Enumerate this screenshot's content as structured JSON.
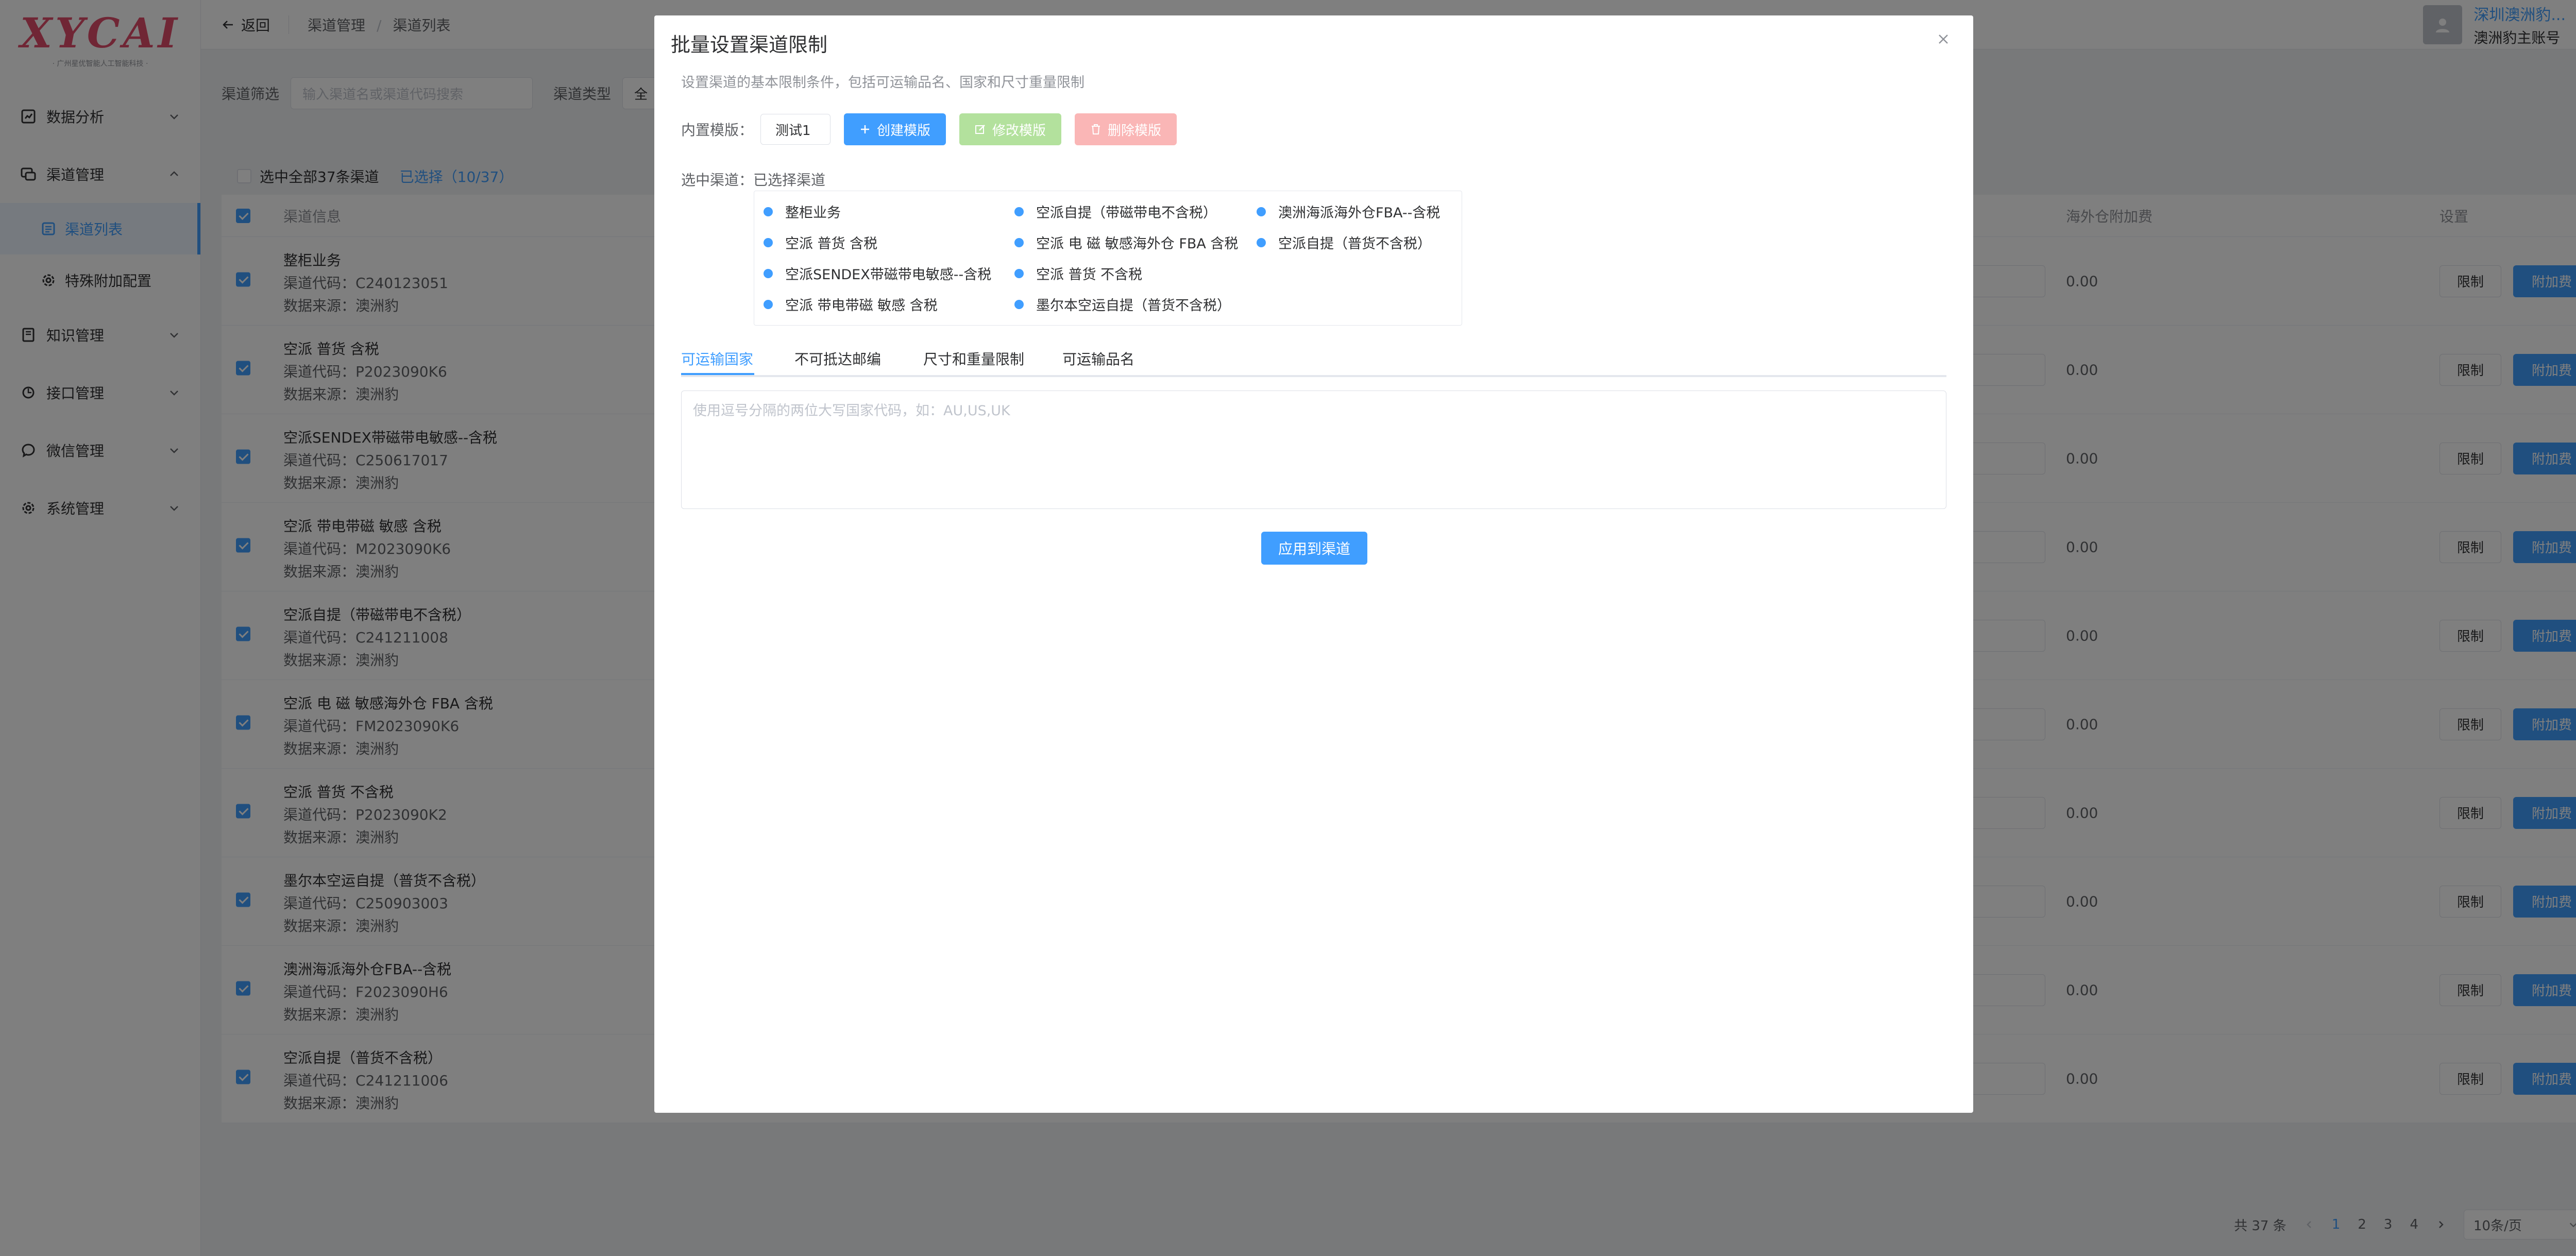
{
  "sidebar": {
    "logo_text": "XYCAI",
    "logo_sub": "· 广州星优智能人工智能科技 ·",
    "menu": {
      "data_analysis": "数据分析",
      "channel_mgmt": "渠道管理",
      "channel_list": "渠道列表",
      "special_fee_config": "特殊附加配置",
      "knowledge_mgmt": "知识管理",
      "api_mgmt": "接口管理",
      "wechat_mgmt": "微信管理",
      "system_mgmt": "系统管理"
    }
  },
  "header": {
    "back": "返回",
    "breadcrumb": [
      "渠道管理",
      "渠道列表"
    ],
    "user_name": "深圳澳洲豹...",
    "user_sub": "澳洲豹主账号"
  },
  "filter": {
    "label": "渠道筛选",
    "search_placeholder": "输入渠道名或渠道代码搜索",
    "type_label": "渠道类型",
    "type_value": "全"
  },
  "list": {
    "select_all": "选中全部37条渠道",
    "selected_count": "已选择（10/37）",
    "col_info": "渠道信息",
    "col_overseas_fee": "海外仓附加费",
    "col_settings": "设置",
    "code_prefix": "渠道代码：",
    "source_prefix": "数据来源：",
    "btn_limit": "限制",
    "btn_extra": "附加费",
    "rows": [
      {
        "name": "整柜业务",
        "code": "C240123051",
        "source": "澳洲豹",
        "fee": "0.00"
      },
      {
        "name": "空派 普货 含税",
        "code": "P2023090K6",
        "source": "澳洲豹",
        "fee": "0.00"
      },
      {
        "name": "空派SENDEX带磁带电敏感--含税",
        "code": "C250617017",
        "source": "澳洲豹",
        "fee": "0.00"
      },
      {
        "name": "空派 带电带磁 敏感 含税",
        "code": "M2023090K6",
        "source": "澳洲豹",
        "fee": "0.00"
      },
      {
        "name": "空派自提（带磁带电不含税）",
        "code": "C241211008",
        "source": "澳洲豹",
        "fee": "0.00"
      },
      {
        "name": "空派 电 磁 敏感海外仓 FBA 含税",
        "code": "FM2023090K6",
        "source": "澳洲豹",
        "fee": "0.00"
      },
      {
        "name": "空派 普货 不含税",
        "code": "P2023090K2",
        "source": "澳洲豹",
        "fee": "0.00"
      },
      {
        "name": "墨尔本空运自提（普货不含税）",
        "code": "C250903003",
        "source": "澳洲豹",
        "fee": "0.00"
      },
      {
        "name": "澳洲海派海外仓FBA--含税",
        "code": "F2023090H6",
        "source": "澳洲豹",
        "fee": "0.00"
      },
      {
        "name": "空派自提（普货不含税）",
        "code": "C241211006",
        "source": "澳洲豹",
        "fee": "0.00"
      }
    ]
  },
  "pagination": {
    "total": "共 37 条",
    "pages": [
      "1",
      "2",
      "3",
      "4"
    ],
    "current": "1",
    "page_size": "10条/页"
  },
  "dialog": {
    "title": "批量设置渠道限制",
    "description": "设置渠道的基本限制条件，包括可运输品名、国家和尺寸重量限制",
    "template_label": "内置模版：",
    "template_value": "测试1",
    "btn_create": "创建模版",
    "btn_edit": "修改模版",
    "btn_delete": "删除模版",
    "selected_label": "选中渠道：已选择渠道",
    "channels": [
      "整柜业务",
      "空派 普货 含税",
      "空派SENDEX带磁带电敏感--含税",
      "空派 带电带磁 敏感 含税",
      "空派自提（带磁带电不含税）",
      "空派 电 磁 敏感海外仓 FBA 含税",
      "空派 普货 不含税",
      "墨尔本空运自提（普货不含税）",
      "澳洲海派海外仓FBA--含税",
      "空派自提（普货不含税）"
    ],
    "tabs": [
      "可运输国家",
      "不可抵达邮编",
      "尺寸和重量限制",
      "可运输品名"
    ],
    "active_tab": "可运输国家",
    "textarea_placeholder": "使用逗号分隔的两位大写国家代码，如：AU,US,UK",
    "btn_apply": "应用到渠道"
  },
  "colors": {
    "primary": "#409eff",
    "success_disabled": "#b3e19d",
    "danger_disabled": "#fab6b6",
    "logo": "#e04d6a"
  }
}
